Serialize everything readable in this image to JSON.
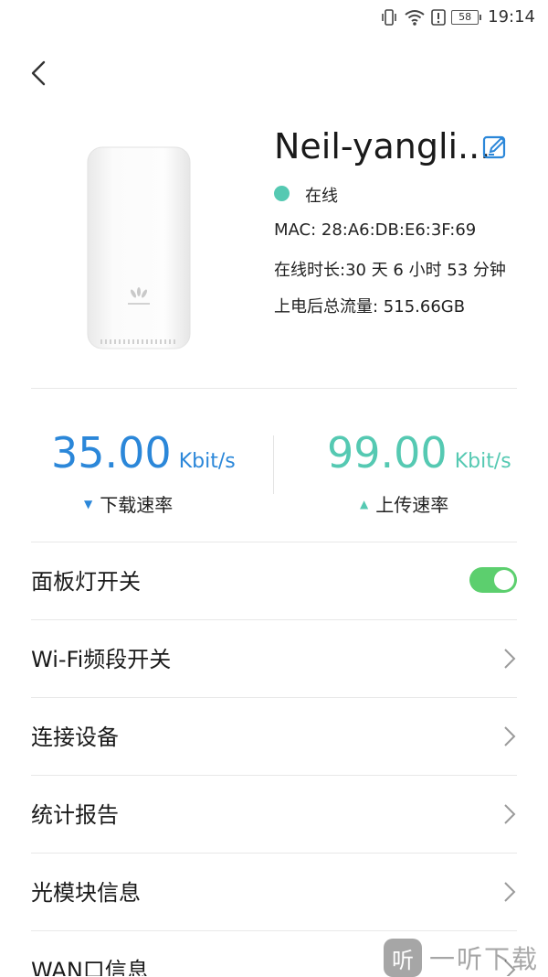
{
  "status_bar": {
    "time": "19:14",
    "battery": "58",
    "icons": [
      "vibrate-icon",
      "wifi-icon",
      "alert-icon",
      "battery-icon"
    ]
  },
  "device": {
    "name": "Neil-yangli...",
    "status": "在线",
    "status_color": "#55c9b2",
    "mac": "MAC:  28:A6:DB:E6:3F:69",
    "online_time": "在线时长:30 天 6 小时 53 分钟",
    "total_traffic": "上电后总流量:  515.66GB",
    "brand_logo": "HUAWEI"
  },
  "speeds": {
    "download": {
      "value": "35.00",
      "unit": "Kbit/s",
      "label": "下载速率",
      "color": "#2b87d9"
    },
    "upload": {
      "value": "99.00",
      "unit": "Kbit/s",
      "label": "上传速率",
      "color": "#55c9b2"
    }
  },
  "settings": [
    {
      "label": "面板灯开关",
      "type": "toggle",
      "on": true
    },
    {
      "label": "Wi-Fi频段开关",
      "type": "link"
    },
    {
      "label": "连接设备",
      "type": "link"
    },
    {
      "label": "统计报告",
      "type": "link"
    },
    {
      "label": "光模块信息",
      "type": "link"
    },
    {
      "label": "WAN口信息",
      "type": "link"
    }
  ],
  "watermark": {
    "logo": "听",
    "text": "一听下载"
  }
}
